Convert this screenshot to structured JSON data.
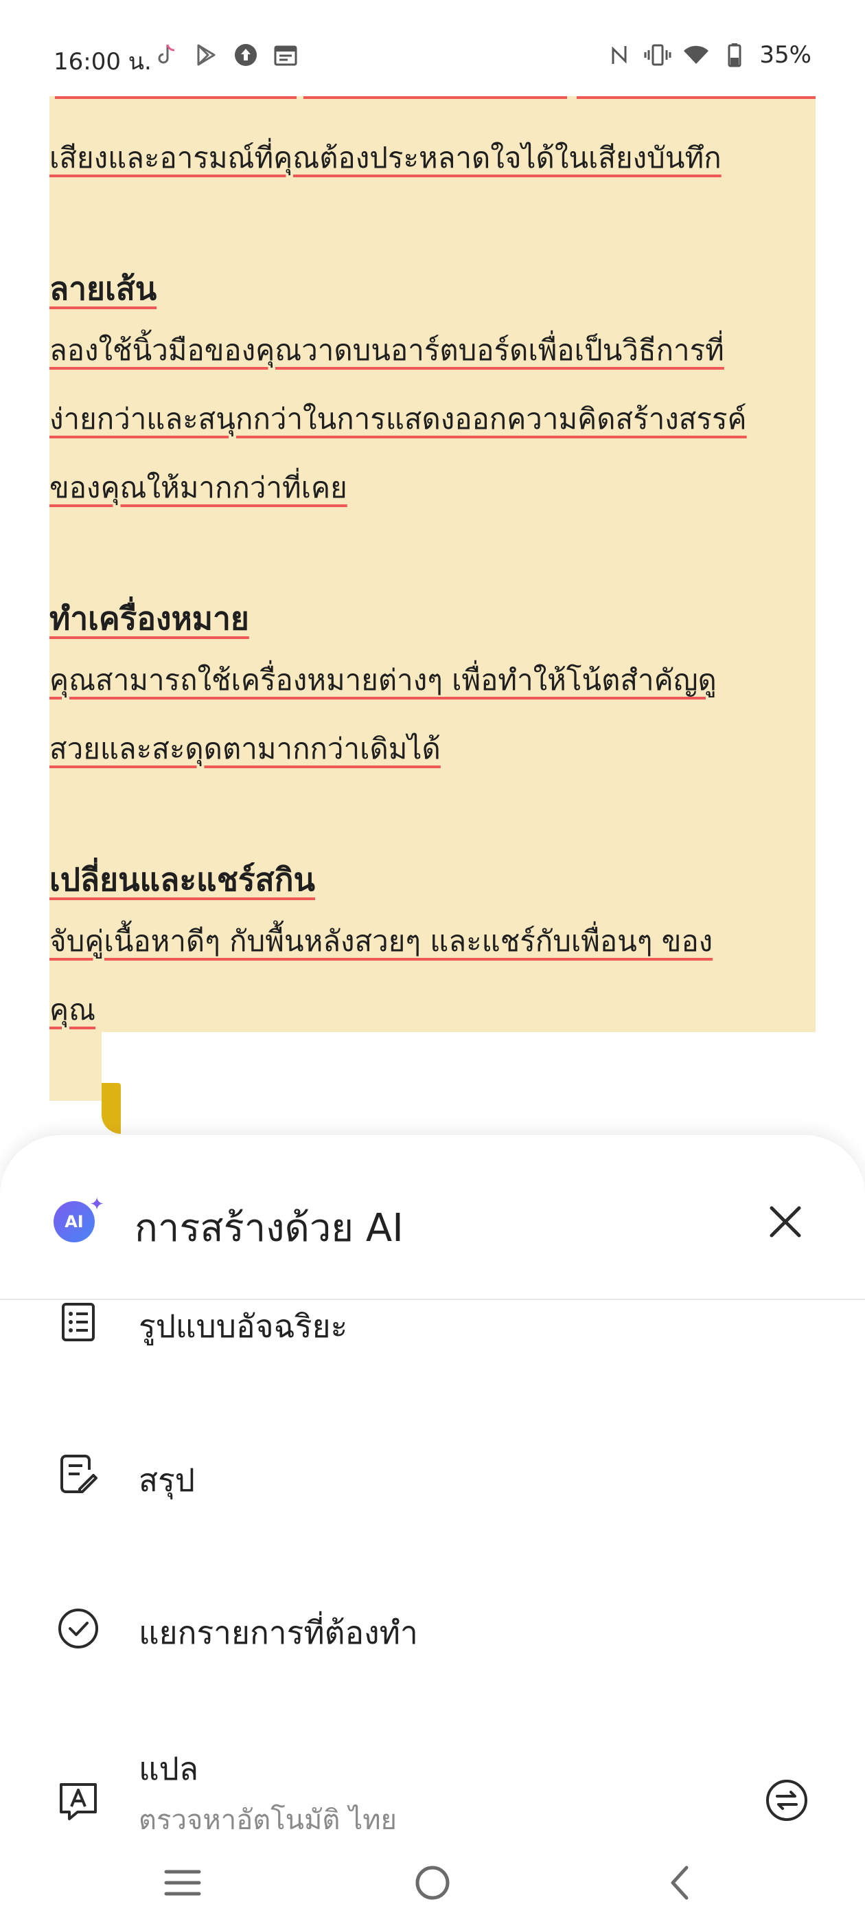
{
  "status_bar": {
    "time": "16:00 น.",
    "battery": "35%"
  },
  "note": {
    "lines": [
      {
        "type": "text",
        "text": "เสียงและอารมณ์ที่คุณต้องประหลาดใจได้ในเสียงบันทึก"
      },
      {
        "type": "spacer"
      },
      {
        "type": "heading",
        "text": "ลายเส้น"
      },
      {
        "type": "text",
        "text": "ลองใช้นิ้วมือของคุณวาดบนอาร์ตบอร์ดเพื่อเป็นวิธีการที่"
      },
      {
        "type": "text",
        "text": "ง่ายกว่าและสนุกกว่าในการแสดงออกความคิดสร้างสรรค์"
      },
      {
        "type": "text",
        "text": "ของคุณให้มากกว่าที่เคย"
      },
      {
        "type": "spacer"
      },
      {
        "type": "heading",
        "text": "ทำเครื่องหมาย"
      },
      {
        "type": "text",
        "text": "คุณสามารถใช้เครื่องหมายต่างๆ เพื่อทำให้โน้ตสำคัญดู"
      },
      {
        "type": "text",
        "text": "สวยและสะดุดตามากกว่าเดิมได้"
      },
      {
        "type": "spacer"
      },
      {
        "type": "heading",
        "text": "เปลี่ยนและแชร์สกิน"
      },
      {
        "type": "text",
        "text": "จับคู่เนื้อหาดีๆ กับพื้นหลังสวยๆ และแชร์กับเพื่อนๆ ของ"
      },
      {
        "type": "text",
        "text": "คุณ"
      }
    ]
  },
  "sheet": {
    "badge": "AI",
    "title": "การสร้างด้วย AI",
    "items": [
      {
        "label": "รูปแบบอัจฉริยะ",
        "icon": "list-icon"
      },
      {
        "label": "สรุป",
        "icon": "summary-icon"
      },
      {
        "label": "แยกรายการที่ต้องทำ",
        "icon": "check-circle-icon"
      },
      {
        "label": "แปล",
        "sublabel": "ตรวจหาอัตโนมัติ ไทย",
        "icon": "translate-icon"
      }
    ]
  },
  "nav_bar": {
    "icons": [
      "menu-icon",
      "home-icon",
      "back-icon"
    ]
  }
}
